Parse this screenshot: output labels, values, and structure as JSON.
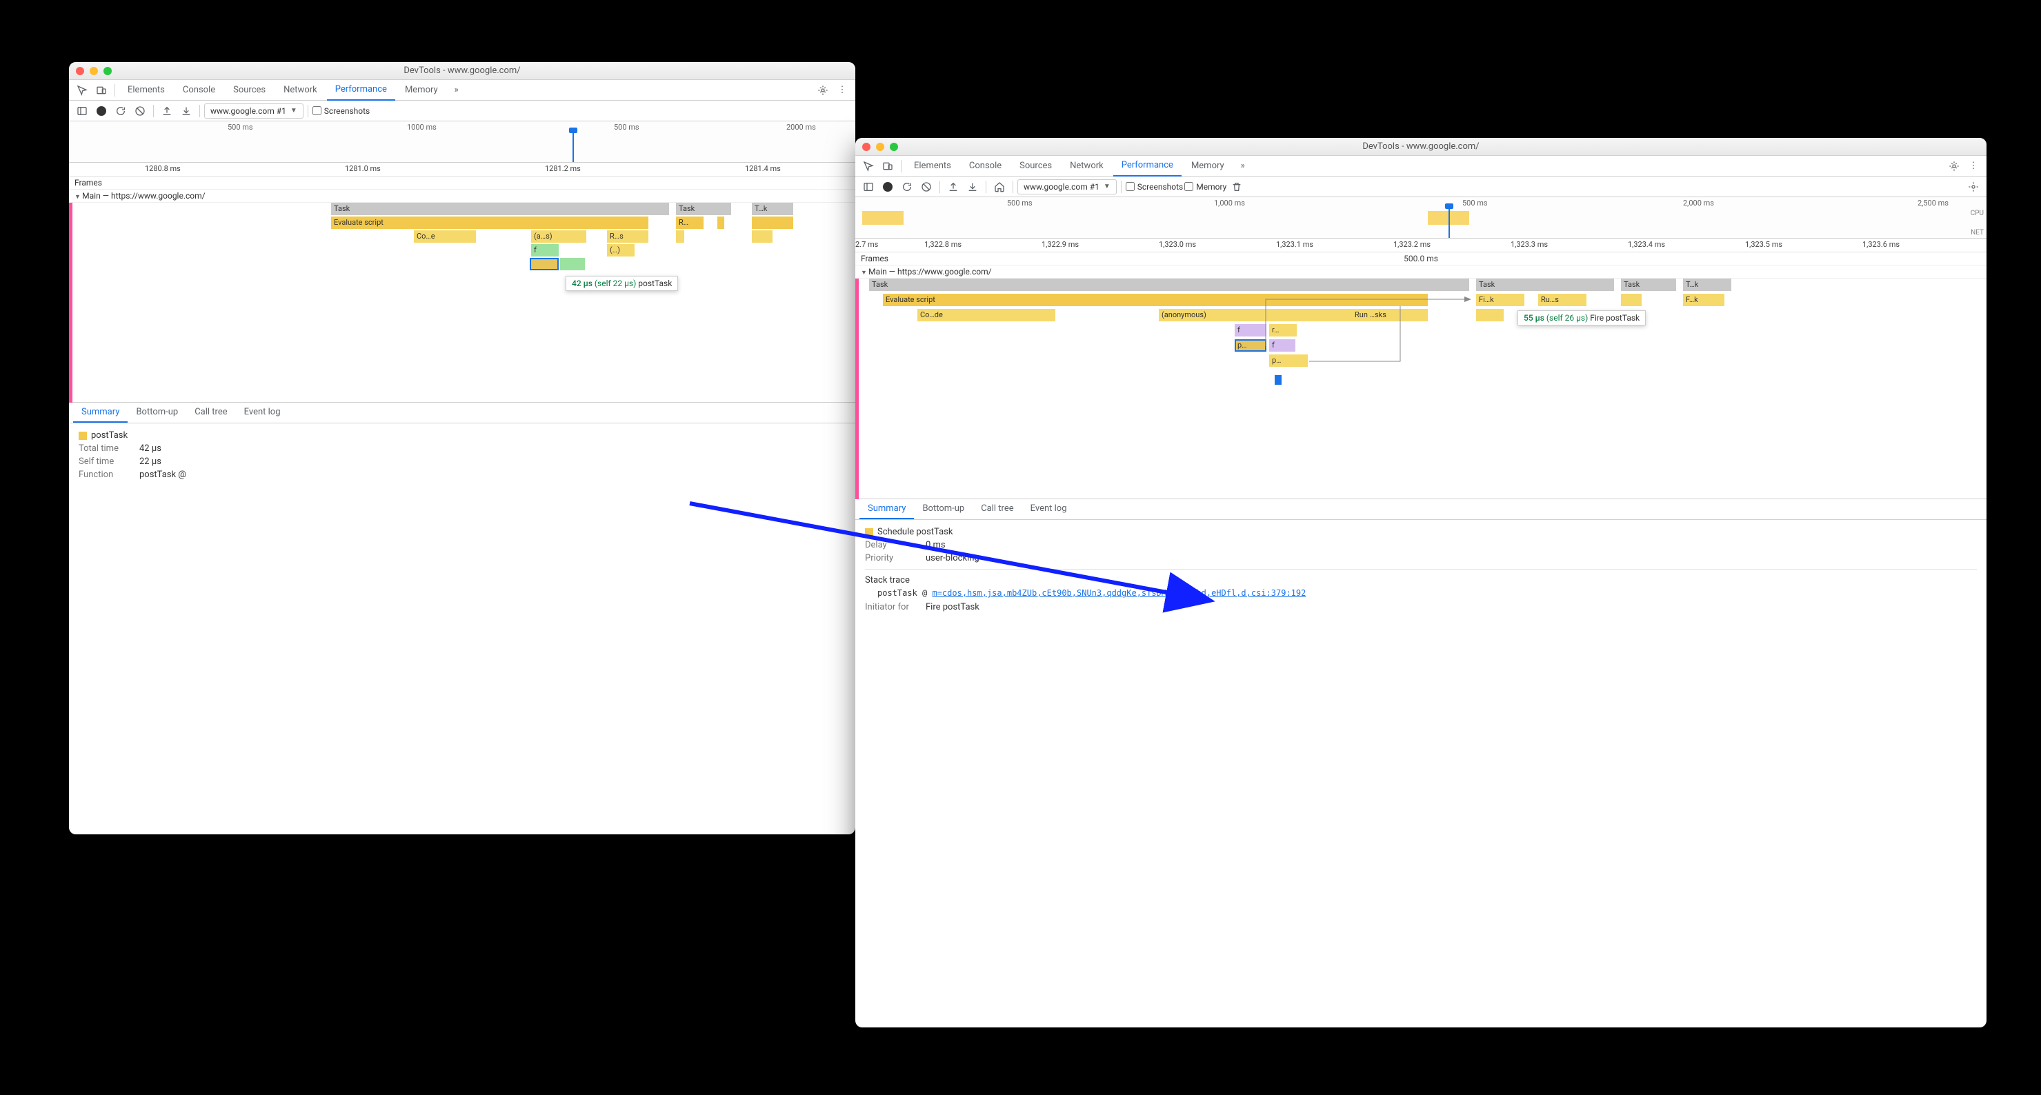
{
  "windowA": {
    "title": "DevTools - www.google.com/",
    "tabs": [
      "Elements",
      "Console",
      "Sources",
      "Network",
      "Performance",
      "Memory"
    ],
    "activeTab": "Performance",
    "recordingName": "www.google.com #1",
    "screenshotsLabel": "Screenshots",
    "overviewTicks": [
      "500 ms",
      "1000 ms",
      "500 ms",
      "2000 ms"
    ],
    "detailTicks": [
      "1280.8 ms",
      "1281.0 ms",
      "1281.2 ms",
      "1281.4 ms"
    ],
    "framesLabel": "Frames",
    "mainLabel": "Main — https://www.google.com/",
    "flame": {
      "task1": "Task",
      "task2": "Task",
      "task3": "T…k",
      "eval": "Evaluate script",
      "run": "R…",
      "coe": "Co…e",
      "as": "(a…s)",
      "rs": "R…s",
      "f": "f",
      "paren": "(…)"
    },
    "tooltip": {
      "time": "42 µs",
      "self": "(self 22 µs)",
      "name": "postTask"
    },
    "detailTabs": [
      "Summary",
      "Bottom-up",
      "Call tree",
      "Event log"
    ],
    "activeDetailTab": "Summary",
    "summary": {
      "title": "postTask",
      "totalLabel": "Total time",
      "totalValue": "42 µs",
      "selfLabel": "Self time",
      "selfValue": "22 µs",
      "fnLabel": "Function",
      "fnValue": "postTask @"
    }
  },
  "windowB": {
    "title": "DevTools - www.google.com/",
    "tabs": [
      "Elements",
      "Console",
      "Sources",
      "Network",
      "Performance",
      "Memory"
    ],
    "activeTab": "Performance",
    "recordingName": "www.google.com #1",
    "screenshotsLabel": "Screenshots",
    "memoryLabel": "Memory",
    "overviewTicks": [
      "500 ms",
      "1,000 ms",
      "500 ms",
      "2,000 ms",
      "2,500 ms"
    ],
    "cpuLabel": "CPU",
    "netLabel": "NET",
    "detailTicks": [
      "2.7 ms",
      "1,322.8 ms",
      "1,322.9 ms",
      "1,323.0 ms",
      "1,323.1 ms",
      "1,323.2 ms",
      "1,323.3 ms",
      "1,323.4 ms",
      "1,323.5 ms",
      "1,323.6 ms"
    ],
    "framesLabel": "Frames",
    "framesDur": "500.0 ms",
    "mainLabel": "Main — https://www.google.com/",
    "flame": {
      "task1": "Task",
      "task2": "Task",
      "task3": "Task",
      "task4": "T…k",
      "eval": "Evaluate script",
      "fik": "Fi…k",
      "rus": "Ru…s",
      "fk": "F…k",
      "code": "Co…de",
      "anon": "(anonymous)",
      "runsks": "Run …sks",
      "f": "f",
      "r": "r…",
      "p": "p…",
      "f2": "f",
      "p2": "p…"
    },
    "tooltip": {
      "time": "55 µs",
      "self": "(self 26 µs)",
      "name": "Fire postTask"
    },
    "detailTabs": [
      "Summary",
      "Bottom-up",
      "Call tree",
      "Event log"
    ],
    "activeDetailTab": "Summary",
    "summary": {
      "title": "Schedule postTask",
      "delayLabel": "Delay",
      "delayValue": "0 ms",
      "priorityLabel": "Priority",
      "priorityValue": "user-blocking",
      "stackHdr": "Stack trace",
      "stackFn": "postTask @",
      "stackLink": "m=cdos,hsm,jsa,mb4ZUb,cEt90b,SNUn3,qddgKe,sTsDMc,dtl0hd,eHDfl,d,csi:379:192",
      "initLabel": "Initiator for",
      "initValue": "Fire postTask"
    }
  }
}
